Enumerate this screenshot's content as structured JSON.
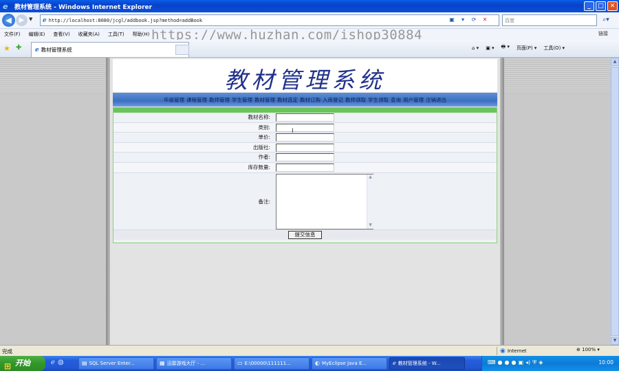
{
  "window": {
    "title": "教材管理系统 - Windows Internet Explorer",
    "controls": [
      "_",
      "□",
      "✕"
    ]
  },
  "toolbar": {
    "back": "◀",
    "forward": "▶",
    "dropdown": "▼",
    "address": "http://localhost:8080/jcgl/addbook.jsp?method=addBook",
    "search_placeholder": "百度",
    "search_icon": "search-icon"
  },
  "menu": {
    "items": [
      "文件(F)",
      "编辑(E)",
      "查看(V)",
      "收藏夹(A)",
      "工具(T)",
      "帮助(H)"
    ],
    "links_label": "链接"
  },
  "watermark": "https://www.huzhan.com/ishop30884",
  "tabbar": {
    "tab_title": "教材管理系统",
    "commands": [
      "⌂ ▾",
      "▣ ▾",
      "🖶 ▾",
      "页面(P) ▾",
      "工具(O) ▾"
    ]
  },
  "page": {
    "banner_title": "教材管理系统",
    "nav": [
      "年级管理",
      "课程管理",
      "教师管理",
      "学生管理",
      "教材管理",
      "教材选定",
      "教材订购",
      "入库登记",
      "教师领取",
      "学生领取",
      "查询",
      "用户管理",
      "注销退出"
    ],
    "form": {
      "fields": [
        {
          "label": "教材名称:",
          "value": ""
        },
        {
          "label": "类别:",
          "value": ""
        },
        {
          "label": "单价:",
          "value": ""
        },
        {
          "label": "出版社:",
          "value": ""
        },
        {
          "label": "作者:",
          "value": ""
        },
        {
          "label": "库存数量:",
          "value": ""
        }
      ],
      "remark_label": "备注:",
      "remark_value": "",
      "submit_label": "提交信息"
    }
  },
  "statusbar": {
    "status": "完成",
    "zone": "Internet",
    "zoom": "100%"
  },
  "taskbar": {
    "start": "开始",
    "buttons": [
      {
        "label": "SQL Server Enter...",
        "active": false
      },
      {
        "label": "迅雷游戏大厅 - ...",
        "active": false
      },
      {
        "label": "E:\\00000\\111111...",
        "active": false
      },
      {
        "label": "MyEclipse Java E...",
        "active": false
      },
      {
        "label": "教材管理系统 - W...",
        "active": true
      }
    ],
    "time": "10:00"
  }
}
